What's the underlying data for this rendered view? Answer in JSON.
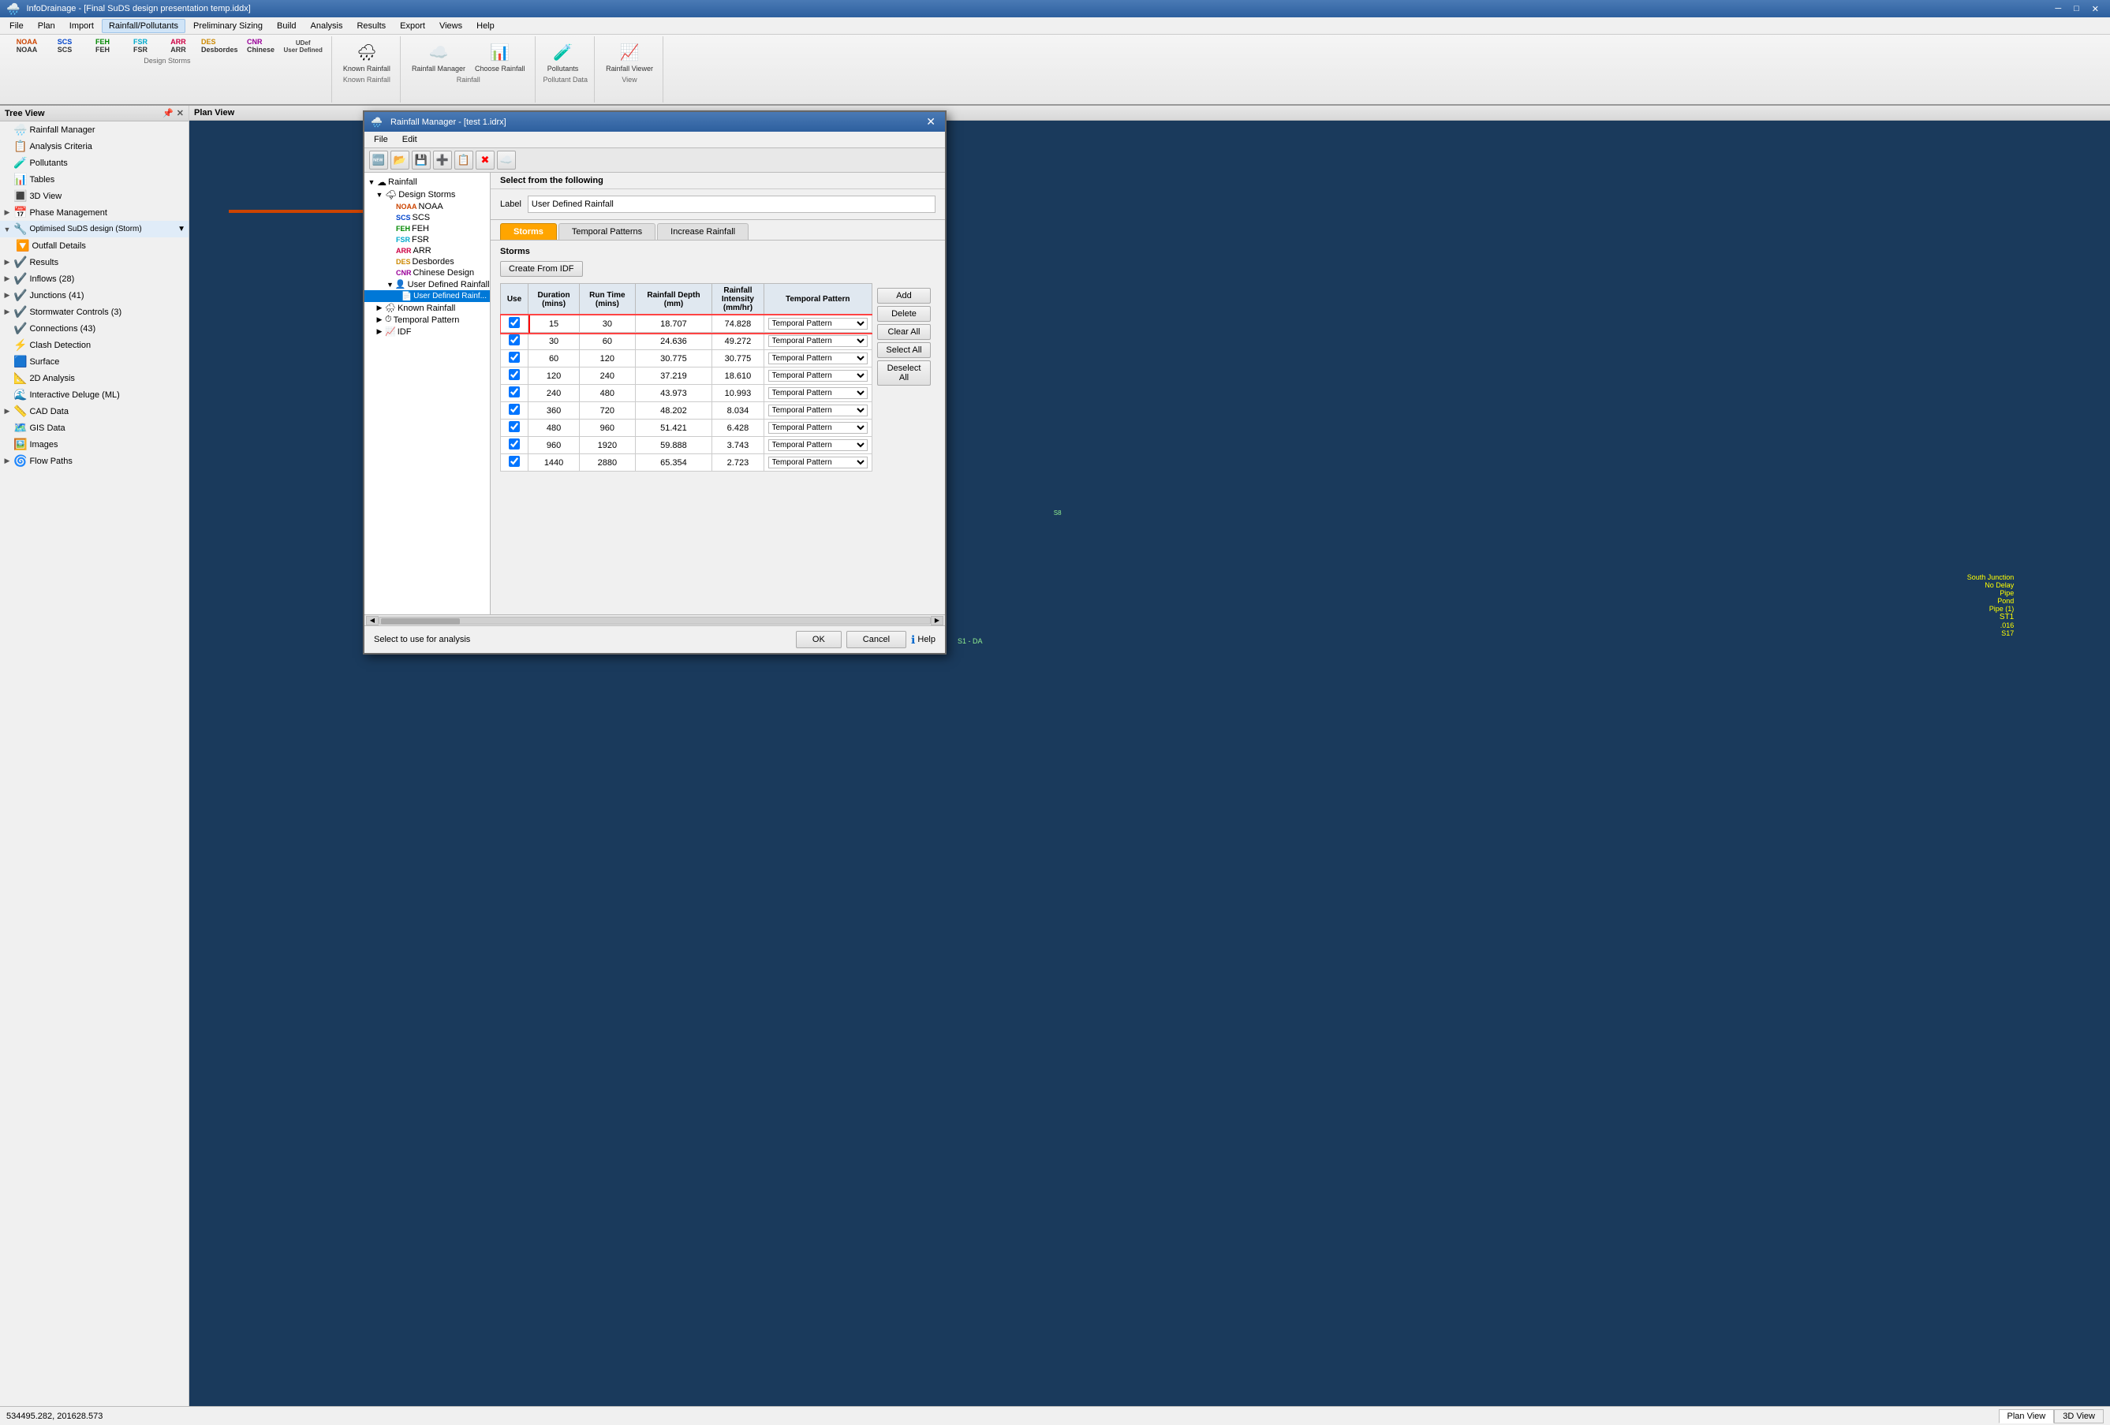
{
  "titleBar": {
    "title": "InfoDrainage - [Final SuDS design presentation temp.iddx]"
  },
  "menuBar": {
    "items": [
      "File",
      "Plan",
      "Import",
      "Rainfall/Pollutants",
      "Preliminary Sizing",
      "Build",
      "Analysis",
      "Results",
      "Export",
      "Views",
      "Help"
    ]
  },
  "ribbon": {
    "designStorms": {
      "label": "Design Storms",
      "items": [
        {
          "label": "NOAA",
          "sublabel": "NOAA",
          "color": "#cc4400"
        },
        {
          "label": "SCS",
          "sublabel": "SCS",
          "color": "#0044cc"
        },
        {
          "label": "FEH",
          "sublabel": "FEH",
          "color": "#008800"
        },
        {
          "label": "FSR",
          "sublabel": "FSR",
          "color": "#00aacc"
        },
        {
          "label": "ARR",
          "sublabel": "ARR",
          "color": "#cc0044"
        },
        {
          "label": "DES",
          "sublabel": "Desbordes",
          "color": "#cc8800"
        },
        {
          "label": "CNR",
          "sublabel": "Chinese",
          "color": "#990099"
        },
        {
          "label": "User Defined",
          "sublabel": "User Defined",
          "color": "#444444"
        }
      ]
    },
    "knownRainfall": {
      "label": "Known Rainfall",
      "groupLabel": "Known Rainfall"
    },
    "rainfall": {
      "label": "Rainfall",
      "items": [
        {
          "label": "Rainfall Manager"
        },
        {
          "label": "Choose Rainfall"
        }
      ]
    },
    "pollutantData": {
      "label": "Pollutant Data",
      "items": [
        {
          "label": "Pollutants"
        }
      ]
    },
    "view": {
      "label": "View",
      "items": [
        {
          "label": "Rainfall Viewer"
        }
      ]
    }
  },
  "sidebar": {
    "title": "Tree View",
    "items": [
      {
        "label": "Rainfall Manager",
        "icon": "rainfall"
      },
      {
        "label": "Analysis Criteria",
        "icon": "analysis"
      },
      {
        "label": "Pollutants",
        "icon": "pollutants"
      },
      {
        "label": "Tables",
        "icon": "tables"
      },
      {
        "label": "3D View",
        "icon": "3dview"
      },
      {
        "label": "Phase Management",
        "icon": "phase"
      },
      {
        "label": "Optimised SuDS design (Storm)",
        "icon": "suds",
        "hasDropdown": true
      },
      {
        "label": "Outfall Details",
        "icon": "outfall"
      },
      {
        "label": "Results",
        "icon": "results"
      },
      {
        "label": "Inflows (28)",
        "icon": "inflows"
      },
      {
        "label": "Junctions (41)",
        "icon": "junctions"
      },
      {
        "label": "Stormwater Controls (3)",
        "icon": "stormwater"
      },
      {
        "label": "Connections (43)",
        "icon": "connections"
      },
      {
        "label": "Clash Detection",
        "icon": "clash"
      },
      {
        "label": "Surface",
        "icon": "surface"
      },
      {
        "label": "2D Analysis",
        "icon": "2d"
      },
      {
        "label": "Interactive Deluge (ML)",
        "icon": "deluge"
      },
      {
        "label": "CAD Data",
        "icon": "cad"
      },
      {
        "label": "GIS Data",
        "icon": "gis"
      },
      {
        "label": "Images",
        "icon": "images"
      },
      {
        "label": "Flow Paths",
        "icon": "flow"
      }
    ]
  },
  "planView": {
    "title": "Plan View"
  },
  "statusBar": {
    "coordinates": "534495.282, 201628.573"
  },
  "viewTabs": [
    {
      "label": "Plan View",
      "active": true
    },
    {
      "label": "3D View",
      "active": false
    }
  ],
  "dialog": {
    "title": "Rainfall Manager - [test 1.idrx]",
    "menu": [
      "File",
      "Edit"
    ],
    "toolbar": [
      "new",
      "open",
      "save",
      "add",
      "copy",
      "delete",
      "cloud"
    ],
    "selectFromLabel": "Select from the following",
    "labelFieldLabel": "Label",
    "labelFieldValue": "User Defined Rainfall",
    "tabs": [
      "Storms",
      "Temporal Patterns",
      "Increase Rainfall"
    ],
    "activeTab": "Storms",
    "stormsTitle": "Storms",
    "createFromIDF": "Create From IDF",
    "tableHeaders": [
      "Use",
      "Duration\n(mins)",
      "Run Time\n(mins)",
      "Rainfall Depth\n(mm)",
      "Rainfall\nIntensity\n(mm/hr)",
      "Temporal Pattern"
    ],
    "actionButtons": [
      "Add",
      "Delete",
      "Clear All",
      "Select All",
      "Deselect All"
    ],
    "rows": [
      {
        "checked": true,
        "duration": 15,
        "runTime": 30,
        "rainfallDepth": 18.707,
        "rainfallIntensity": 74.828,
        "temporalPattern": "Temporal Pattern",
        "selected": true
      },
      {
        "checked": true,
        "duration": 30,
        "runTime": 60,
        "rainfallDepth": 24.636,
        "rainfallIntensity": 49.272,
        "temporalPattern": "Temporal Pattern"
      },
      {
        "checked": true,
        "duration": 60,
        "runTime": 120,
        "rainfallDepth": 30.775,
        "rainfallIntensity": 30.775,
        "temporalPattern": "Temporal Pattern"
      },
      {
        "checked": true,
        "duration": 120,
        "runTime": 240,
        "rainfallDepth": 37.219,
        "rainfallIntensity": 18.61,
        "temporalPattern": "Temporal Pattern"
      },
      {
        "checked": true,
        "duration": 240,
        "runTime": 480,
        "rainfallDepth": 43.973,
        "rainfallIntensity": 10.993,
        "temporalPattern": "Temporal Pattern"
      },
      {
        "checked": true,
        "duration": 360,
        "runTime": 720,
        "rainfallDepth": 48.202,
        "rainfallIntensity": 8.034,
        "temporalPattern": "Temporal Pattern"
      },
      {
        "checked": true,
        "duration": 480,
        "runTime": 960,
        "rainfallDepth": 51.421,
        "rainfallIntensity": 6.428,
        "temporalPattern": "Temporal Pattern"
      },
      {
        "checked": true,
        "duration": 960,
        "runTime": 1920,
        "rainfallDepth": 59.888,
        "rainfallIntensity": 3.743,
        "temporalPattern": "Temporal Pattern"
      },
      {
        "checked": true,
        "duration": 1440,
        "runTime": 2880,
        "rainfallDepth": 65.354,
        "rainfallIntensity": 2.723,
        "temporalPattern": "Temporal Pattern"
      }
    ],
    "footerMsg": "Select to use for analysis",
    "footerHelp": "Help",
    "btnOK": "OK",
    "btnCancel": "Cancel",
    "tree": {
      "items": [
        {
          "label": "Rainfall",
          "level": 0,
          "expand": true,
          "icon": "cloud"
        },
        {
          "label": "Design Storms",
          "level": 1,
          "expand": true,
          "icon": "storms"
        },
        {
          "label": "NOAA",
          "level": 2,
          "icon": "noaa"
        },
        {
          "label": "SCS",
          "level": 2,
          "icon": "scs"
        },
        {
          "label": "FEH",
          "level": 2,
          "icon": "feh"
        },
        {
          "label": "FSR",
          "level": 2,
          "icon": "fsr"
        },
        {
          "label": "ARR",
          "level": 2,
          "icon": "arr"
        },
        {
          "label": "Desbordes",
          "level": 2,
          "icon": "des"
        },
        {
          "label": "Chinese Design",
          "level": 2,
          "icon": "chn"
        },
        {
          "label": "User Defined Rainfall",
          "level": 2,
          "expand": true,
          "icon": "user"
        },
        {
          "label": "User Defined Rainf...",
          "level": 3,
          "icon": "useritem",
          "selected": true
        },
        {
          "label": "Known Rainfall",
          "level": 1,
          "expand": false,
          "icon": "known"
        },
        {
          "label": "Temporal Pattern",
          "level": 1,
          "expand": false,
          "icon": "temporal"
        },
        {
          "label": "IDF",
          "level": 1,
          "expand": false,
          "icon": "idf"
        }
      ]
    }
  }
}
